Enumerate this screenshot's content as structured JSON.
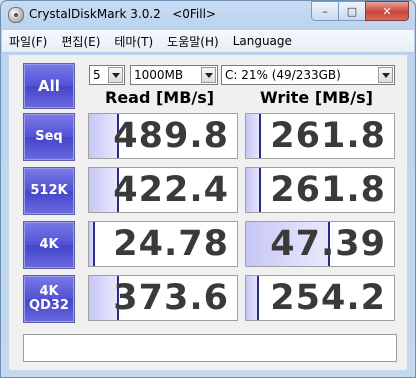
{
  "window": {
    "title": "CrystalDiskMark 3.0.2   <0Fill>",
    "buttons": {
      "minimize": "–",
      "maximize": "□",
      "close": "✕"
    }
  },
  "menu": [
    "파일(F)",
    "편집(E)",
    "테마(T)",
    "도움말(H)",
    "Language"
  ],
  "controls": {
    "all_label": "All",
    "count": "5",
    "size": "1000MB",
    "drive": "C: 21% (49/233GB)"
  },
  "headers": {
    "read": "Read [MB/s]",
    "write": "Write [MB/s]"
  },
  "rows": [
    {
      "label": "Seq",
      "read": "489.8",
      "write": "261.8",
      "read_fill": 0.2,
      "write_fill": 0.1
    },
    {
      "label": "512K",
      "read": "422.4",
      "write": "261.8",
      "read_fill": 0.2,
      "write_fill": 0.1
    },
    {
      "label": "4K",
      "read": "24.78",
      "write": "47.39",
      "read_fill": 0.04,
      "write_fill": 0.57
    },
    {
      "label": "4K\nQD32",
      "read": "373.6",
      "write": "254.2",
      "read_fill": 0.2,
      "write_fill": 0.09
    }
  ],
  "status_text": ""
}
